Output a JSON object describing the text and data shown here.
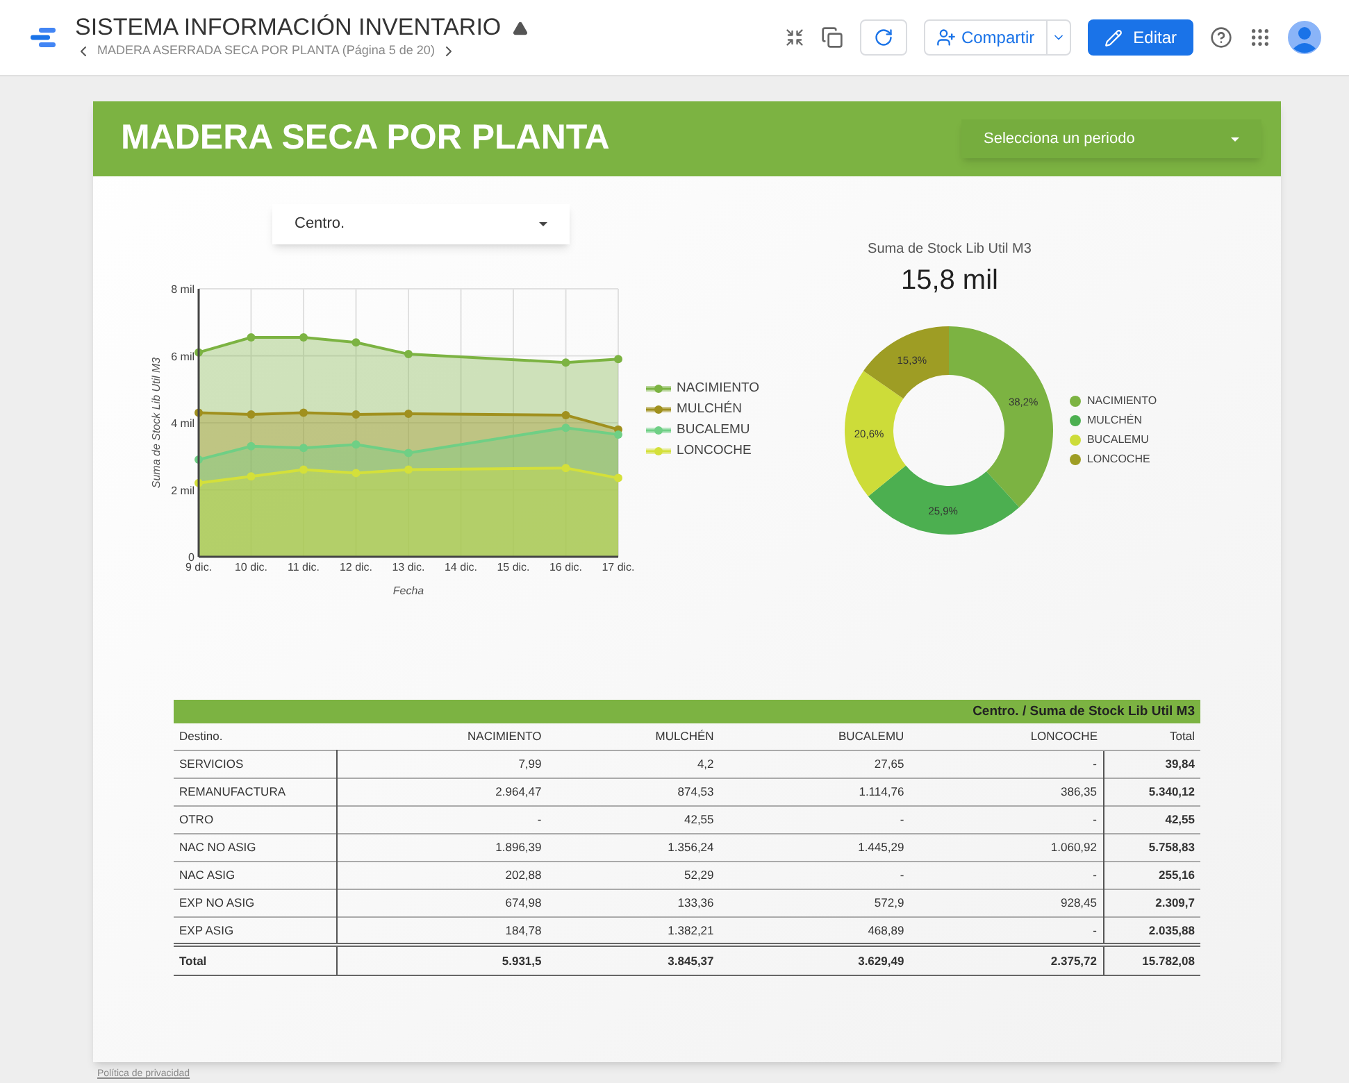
{
  "header": {
    "title": "SISTEMA INFORMACIÓN INVENTARIO",
    "subtitle": "MADERA ASERRADA SECA POR PLANTA (Página 5 de 20)",
    "share": "Compartir",
    "edit": "Editar"
  },
  "page": {
    "title": "MADERA SECA POR PLANTA",
    "period_select": {
      "placeholder": "Selecciona un periodo"
    }
  },
  "filter": {
    "value": "Centro."
  },
  "line_chart": {
    "chart_data": {
      "type": "area",
      "legend": "right",
      "grid": true,
      "xlabel": "Fecha",
      "ylabel": "Suma de Stock Lib Util M3",
      "categories": [
        "9 dic.",
        "10 dic.",
        "11 dic.",
        "12 dic.",
        "13 dic.",
        "14 dic.",
        "15 dic.",
        "16 dic.",
        "17 dic."
      ],
      "ylim": [
        0,
        8
      ],
      "yticks": [
        {
          "value": 0,
          "label": "0"
        },
        {
          "value": 2,
          "label": "2 mil"
        },
        {
          "value": 4,
          "label": "4 mil"
        },
        {
          "value": 6,
          "label": "6 mil"
        },
        {
          "value": 8,
          "label": "8 mil"
        }
      ],
      "series": [
        {
          "name": "NACIMIENTO",
          "color": "#7cb342",
          "values": [
            6.1,
            6.55,
            6.55,
            6.4,
            6.05,
            null,
            null,
            5.8,
            5.9
          ]
        },
        {
          "name": "MULCHÉN",
          "color": "#a0901e",
          "values": [
            4.3,
            4.25,
            4.3,
            4.25,
            4.27,
            null,
            null,
            4.23,
            3.8
          ]
        },
        {
          "name": "BUCALEMU",
          "color": "#6fcf85",
          "values": [
            2.9,
            3.3,
            3.25,
            3.35,
            3.1,
            null,
            null,
            3.85,
            3.65
          ]
        },
        {
          "name": "LONCOCHE",
          "color": "#d4e03a",
          "values": [
            2.2,
            2.4,
            2.6,
            2.5,
            2.6,
            null,
            null,
            2.65,
            2.35
          ]
        }
      ]
    }
  },
  "scorecard": {
    "label": "Suma de Stock Lib Util M3",
    "value": "15,8 mil"
  },
  "donut_chart": {
    "chart_data": {
      "type": "donut",
      "legend": "right",
      "categories": [
        "NACIMIENTO",
        "MULCHÉN",
        "BUCALEMU",
        "LONCOCHE"
      ],
      "series": [
        {
          "values": [
            38.2,
            25.9,
            20.6,
            15.3
          ]
        }
      ],
      "value_labels": [
        "38,2%",
        "25,9%",
        "20,6%",
        "15,3%"
      ]
    },
    "slices": [
      {
        "color": "#7cb342"
      },
      {
        "color": "#4caf50"
      },
      {
        "color": "#cddc39"
      },
      {
        "color": "#9e9d24"
      }
    ]
  },
  "table": {
    "caption": "Centro. / Suma de Stock Lib Util M3",
    "columns": [
      "Destino.",
      "NACIMIENTO",
      "MULCHÉN",
      "BUCALEMU",
      "LONCOCHE",
      "Total"
    ],
    "rows": [
      [
        "SERVICIOS",
        "7,99",
        "4,2",
        "27,65",
        "-",
        "39,84"
      ],
      [
        "REMANUFACTURA",
        "2.964,47",
        "874,53",
        "1.114,76",
        "386,35",
        "5.340,12"
      ],
      [
        "OTRO",
        "-",
        "42,55",
        "-",
        "-",
        "42,55"
      ],
      [
        "NAC NO ASIG",
        "1.896,39",
        "1.356,24",
        "1.445,29",
        "1.060,92",
        "5.758,83"
      ],
      [
        "NAC ASIG",
        "202,88",
        "52,29",
        "-",
        "-",
        "255,16"
      ],
      [
        "EXP NO ASIG",
        "674,98",
        "133,36",
        "572,9",
        "928,45",
        "2.309,7"
      ],
      [
        "EXP ASIG",
        "184,78",
        "1.382,21",
        "468,89",
        "-",
        "2.035,88"
      ]
    ],
    "total": [
      "Total",
      "5.931,5",
      "3.845,37",
      "3.629,49",
      "2.375,72",
      "15.782,08"
    ]
  },
  "footer": {
    "link": "Política de privacidad"
  }
}
